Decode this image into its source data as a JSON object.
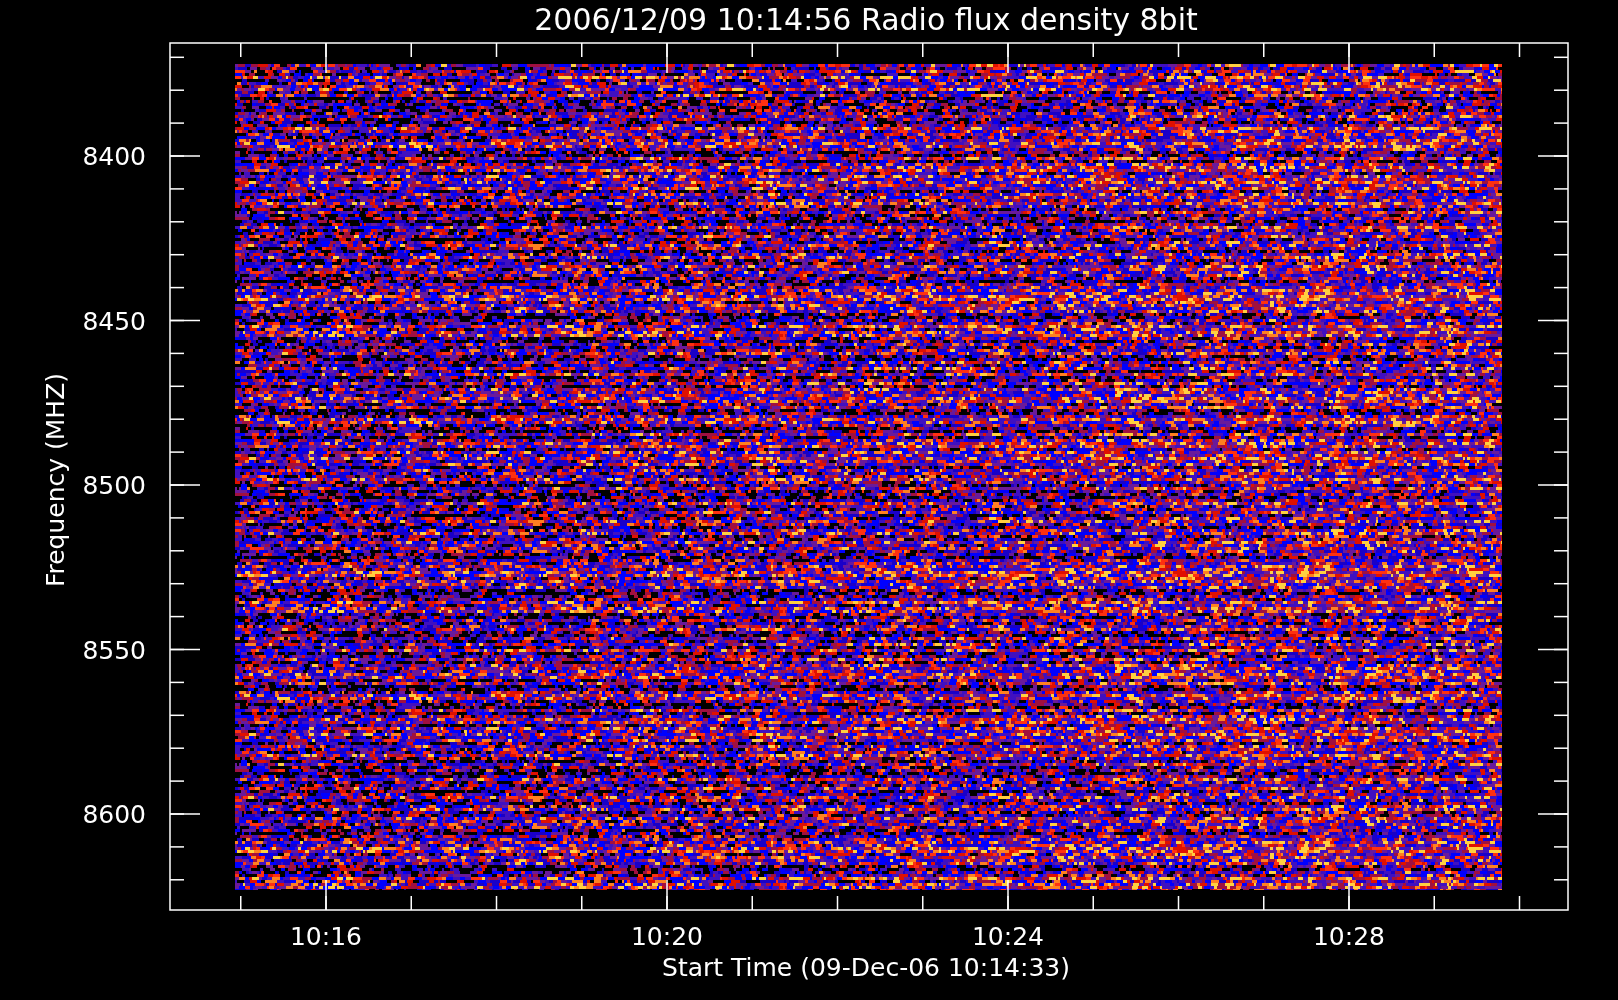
{
  "title": "2006/12/09 10:14:56 Radio flux density 8bit",
  "y_axis": {
    "label": "Frequency (MHZ)",
    "ticks": [
      "8400",
      "8450",
      "8500",
      "8550",
      "8600"
    ]
  },
  "x_axis": {
    "label": "Start Time (09-Dec-06 10:14:33)",
    "ticks": [
      "10:16",
      "10:20",
      "10:24",
      "10:28"
    ]
  }
}
